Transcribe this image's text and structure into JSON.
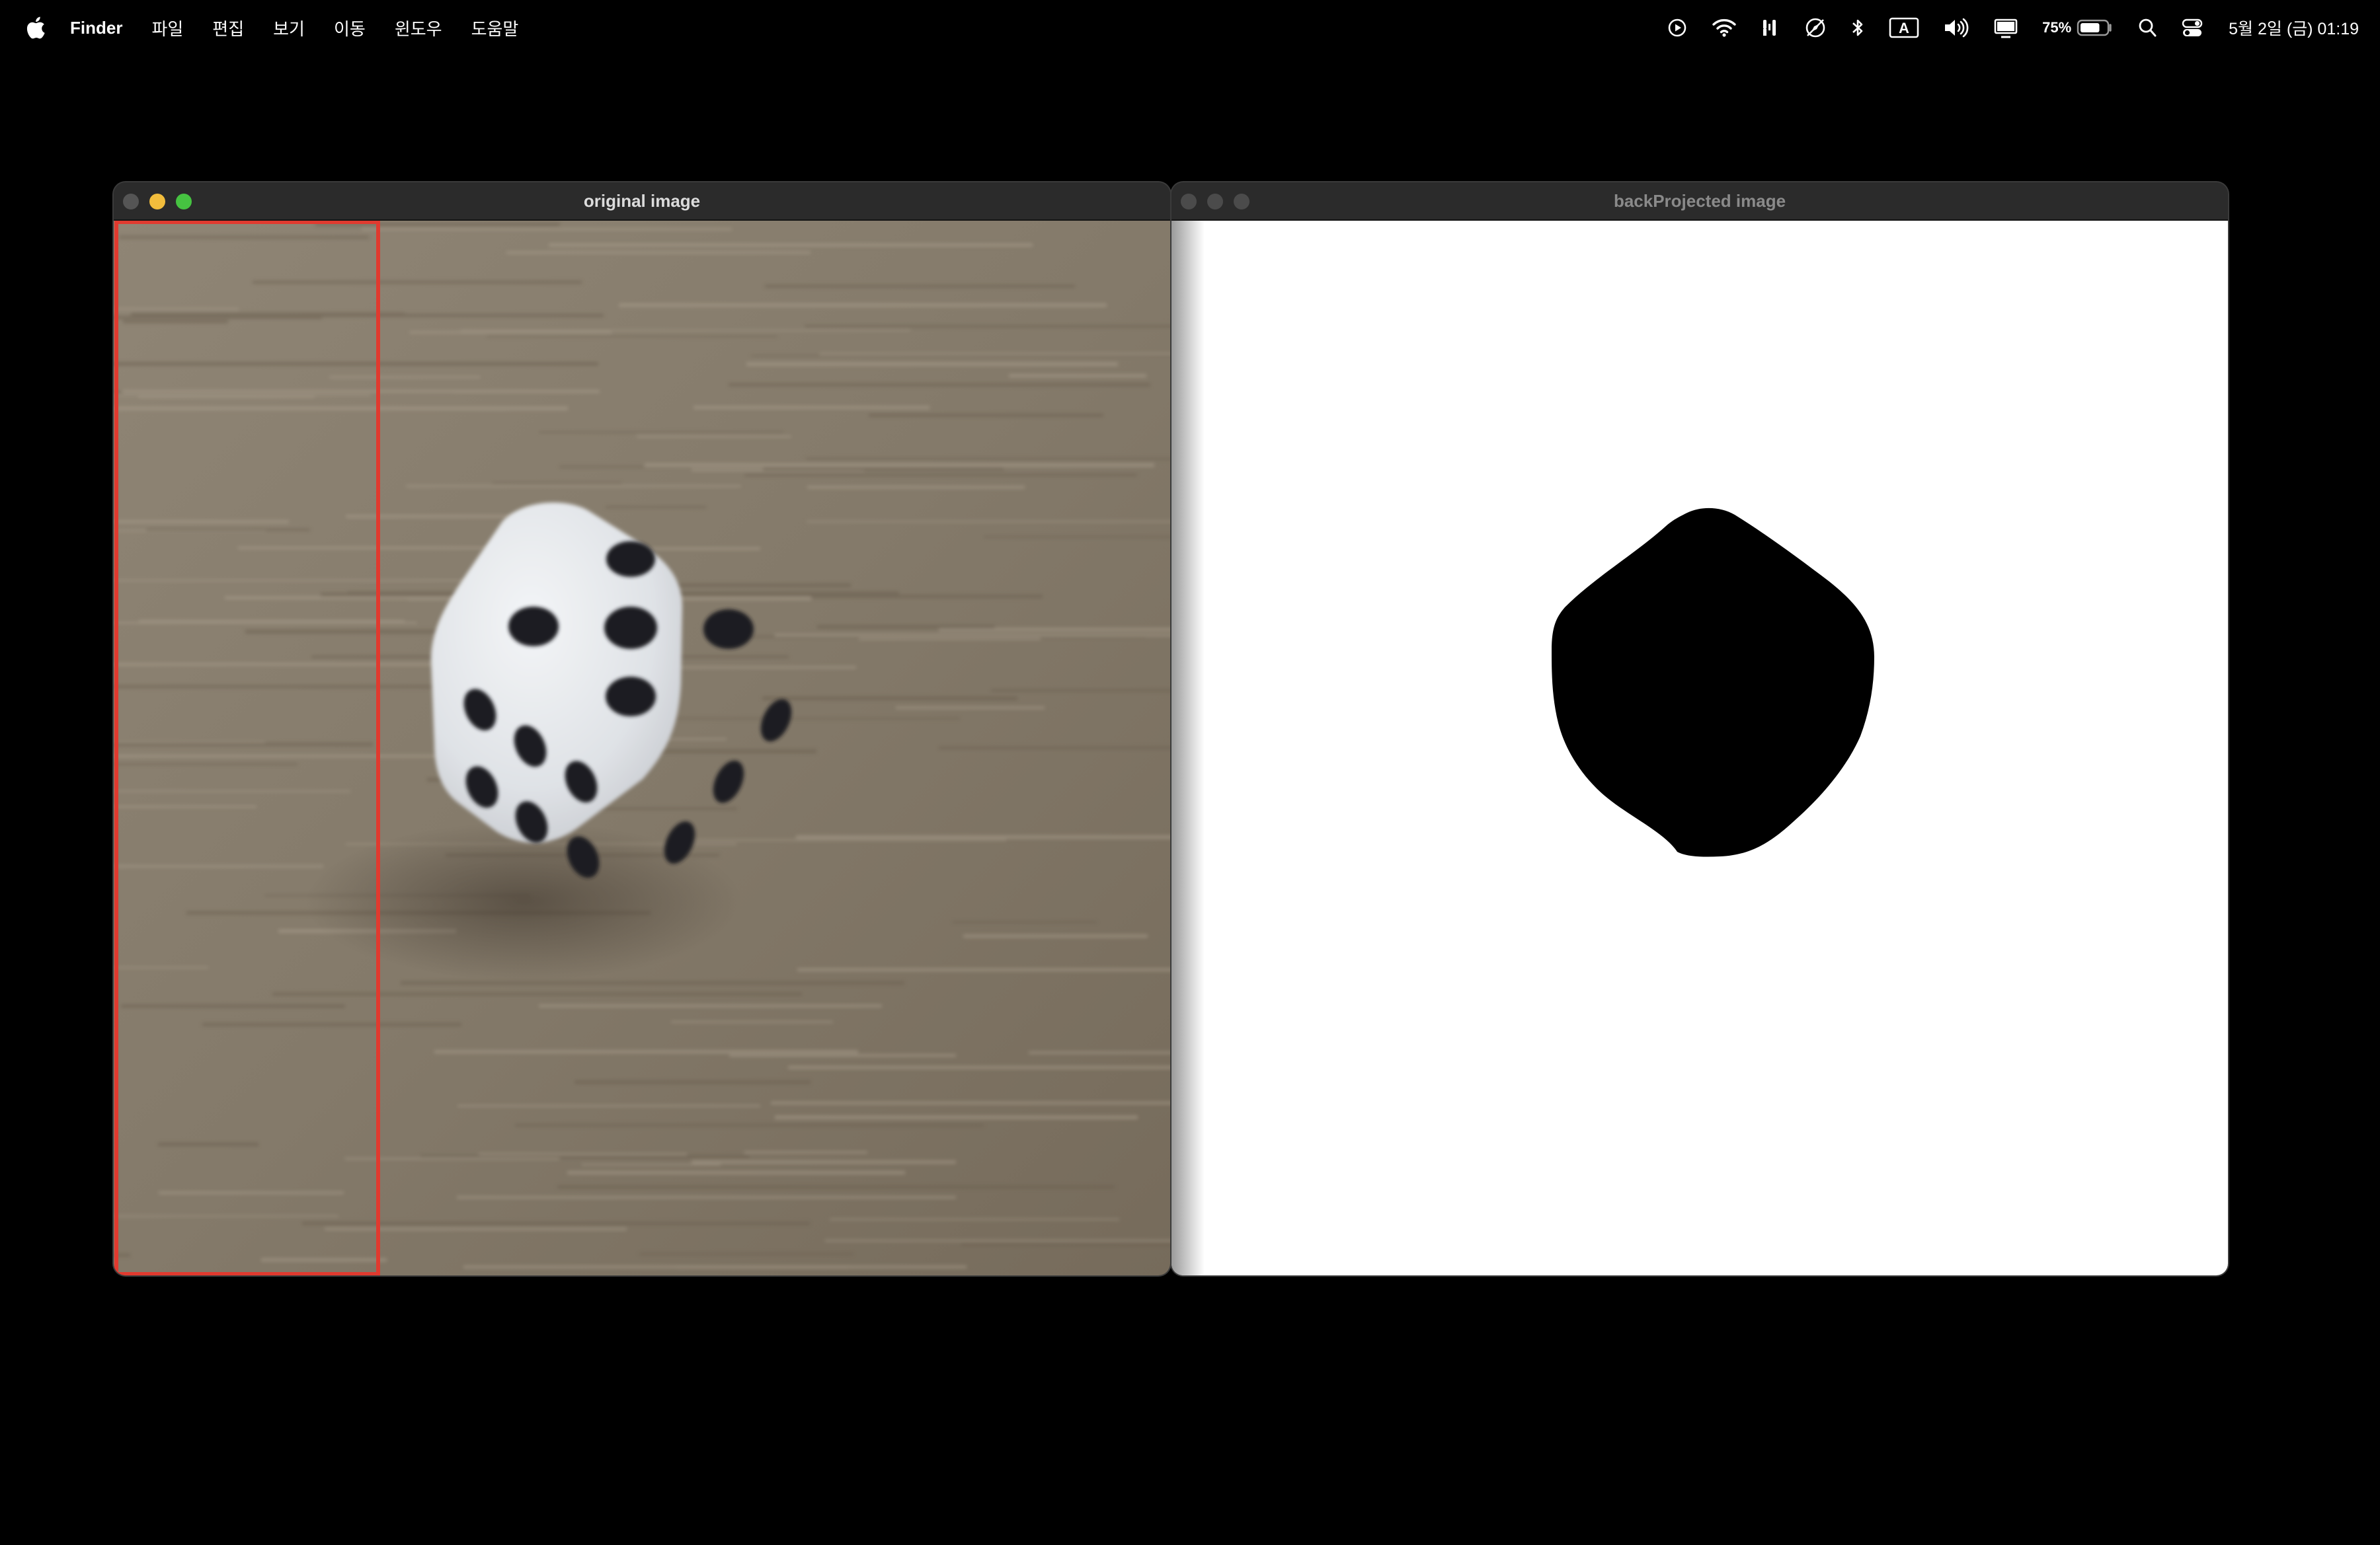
{
  "menubar": {
    "apple_icon": "apple-logo-icon",
    "app_name": "Finder",
    "items": [
      "파일",
      "편집",
      "보기",
      "이동",
      "윈도우",
      "도움말"
    ],
    "status_icons": [
      "play-circle-icon",
      "wifi-icon",
      "tuning-fork-icon",
      "compass-icon",
      "bluetooth-icon",
      "input-source-icon",
      "volume-icon",
      "display-icon",
      "battery-icon",
      "spotlight-search-icon",
      "control-center-icon"
    ],
    "input_source_label": "A",
    "battery_percent": "75%",
    "battery_level": 0.75,
    "clock": "5월 2일 (금) 01:19"
  },
  "windows": {
    "original": {
      "title": "original image",
      "content": "photo of a white six-sided die on a wooden table with a red selection rectangle along the left edge",
      "selection_color": "#e03a2f"
    },
    "backprojected": {
      "title": "backProjected image",
      "content": "white canvas with a single black blob where the die is"
    }
  }
}
